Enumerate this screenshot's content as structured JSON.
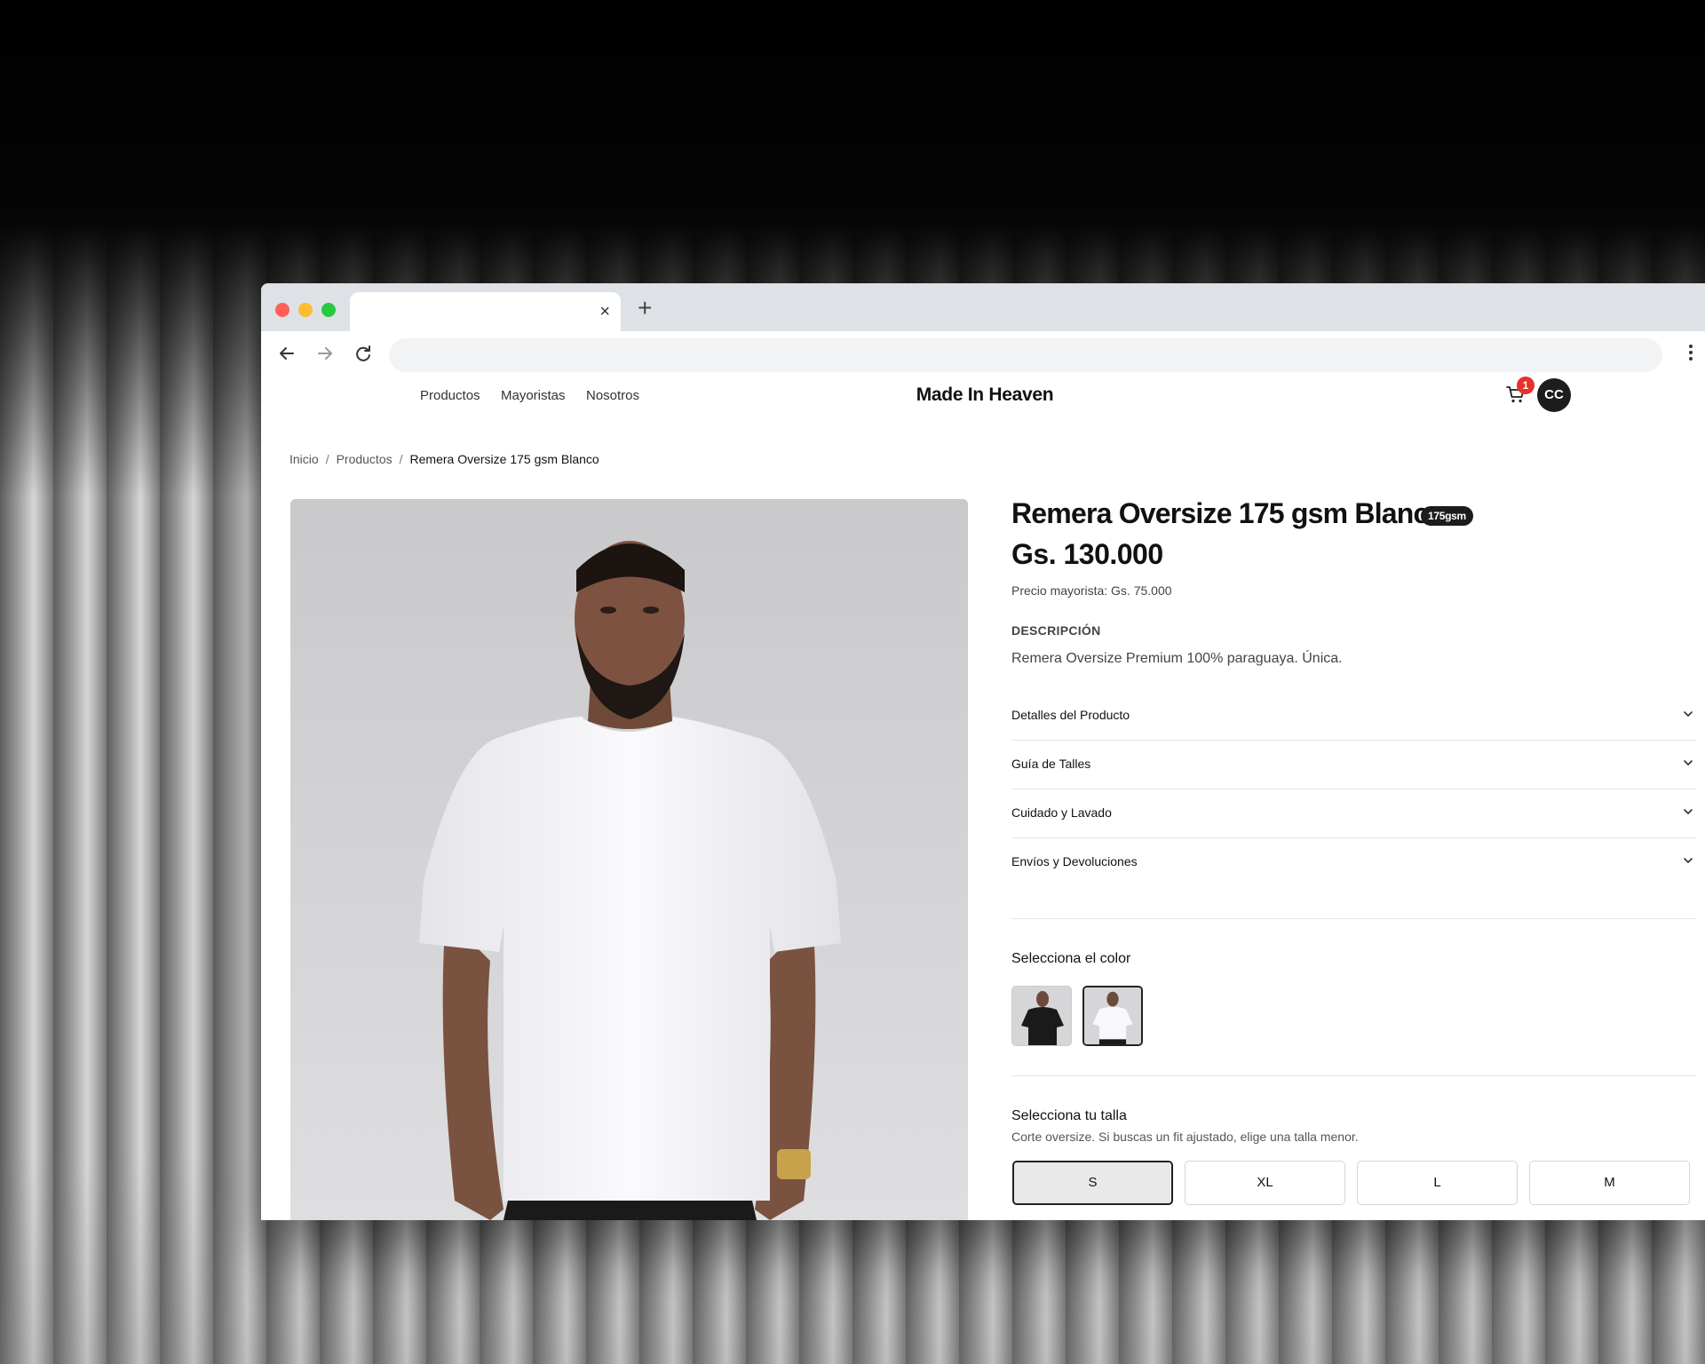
{
  "browser": {
    "tab_close": "×",
    "new_tab": "+"
  },
  "site": {
    "nav": [
      "Productos",
      "Mayoristas",
      "Nosotros"
    ],
    "brand": "Made In Heaven",
    "cart_count": "1",
    "avatar_initials": "CC"
  },
  "breadcrumb": {
    "items": [
      "Inicio",
      "Productos"
    ],
    "separator": "/",
    "current": "Remera Oversize 175 gsm Blanco"
  },
  "product": {
    "title": "Remera Oversize 175 gsm Blanco",
    "badge": "175gsm",
    "price": "Gs. 130.000",
    "wholesale_price": "Precio mayorista: Gs. 75.000",
    "description_label": "DESCRIPCIÓN",
    "description": "Remera Oversize Premium 100% paraguaya. Única.",
    "accordion": [
      "Detalles del Producto",
      "Guía de Talles",
      "Cuidado y Lavado",
      "Envíos y Devoluciones"
    ],
    "color_label": "Selecciona el color",
    "colors": [
      "black",
      "white"
    ],
    "selected_color": "white",
    "size_label": "Selecciona tu talla",
    "size_note": "Corte oversize. Si buscas un fit ajustado, elige una talla menor.",
    "sizes": [
      "S",
      "XL",
      "L",
      "M"
    ],
    "selected_size": "S"
  },
  "colors": {
    "accent": "#111111",
    "badge_red": "#e5322d",
    "traffic_red": "#ff5f57",
    "traffic_yellow": "#febc2e",
    "traffic_green": "#28c840"
  }
}
